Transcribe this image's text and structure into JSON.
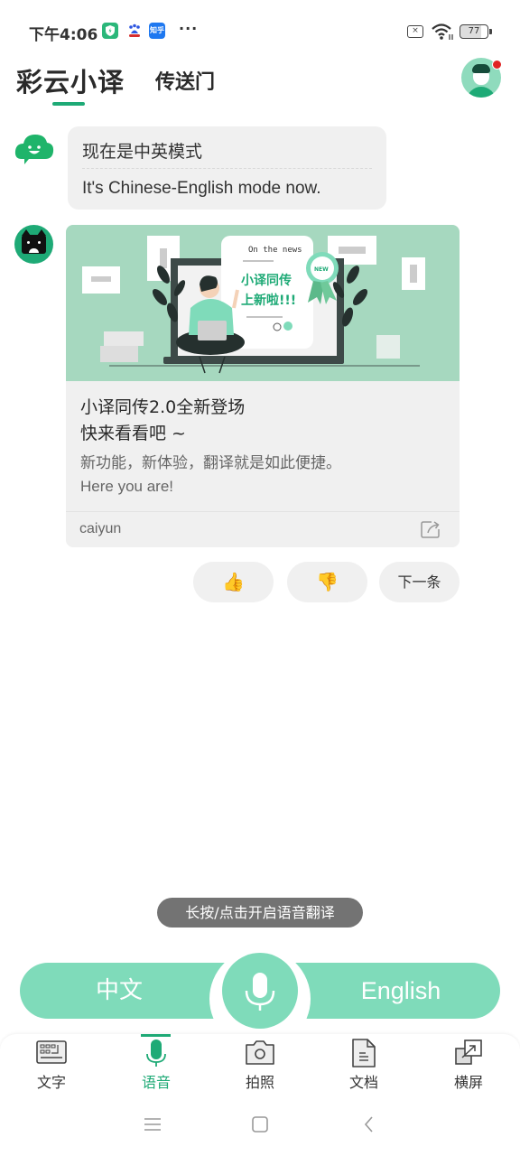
{
  "status_bar": {
    "time": "下午4:06",
    "apps": [
      "shield-app",
      "baidu-app",
      "zhihu-app"
    ],
    "zhihu_label": "知乎",
    "baidu_label": "du",
    "more": "···",
    "sim_label": "×",
    "battery": "77"
  },
  "header": {
    "tabs": [
      {
        "label": "彩云小译",
        "active": true
      },
      {
        "label": "传送门",
        "active": false
      }
    ],
    "has_notification": true
  },
  "chat": {
    "mode_message": {
      "cn": "现在是中英模式",
      "en": "It's Chinese-English mode now."
    },
    "card": {
      "banner": {
        "header_text": "On the news",
        "headline_line1": "小译同传",
        "headline_line2": "上新啦!!!",
        "badge": "NEW"
      },
      "title_line1": "小译同传2.0全新登场",
      "title_line2": "快来看看吧 ~",
      "desc_line1": "新功能，新体验，翻译就是如此便捷。",
      "desc_line2": "Here you are!",
      "source": "caiyun"
    },
    "reactions": {
      "like_icon": "👍",
      "dislike_icon": "👎",
      "next_label": "下一条"
    }
  },
  "hint": "长按/点击开启语音翻译",
  "language_bar": {
    "source": "中文",
    "target": "English"
  },
  "bottom_nav": {
    "items": [
      {
        "label": "文字",
        "icon": "keyboard-icon",
        "active": false
      },
      {
        "label": "语音",
        "icon": "microphone-icon",
        "active": true
      },
      {
        "label": "拍照",
        "icon": "camera-icon",
        "active": false
      },
      {
        "label": "文档",
        "icon": "document-icon",
        "active": false
      },
      {
        "label": "横屏",
        "icon": "landscape-icon",
        "active": false
      }
    ]
  },
  "colors": {
    "accent": "#1eaa76",
    "mint": "#7fdbba",
    "banner_bg": "#a6d8bf",
    "bubble_bg": "#f0f0f0",
    "hint_bg": "#737373",
    "notification": "#e02424"
  }
}
